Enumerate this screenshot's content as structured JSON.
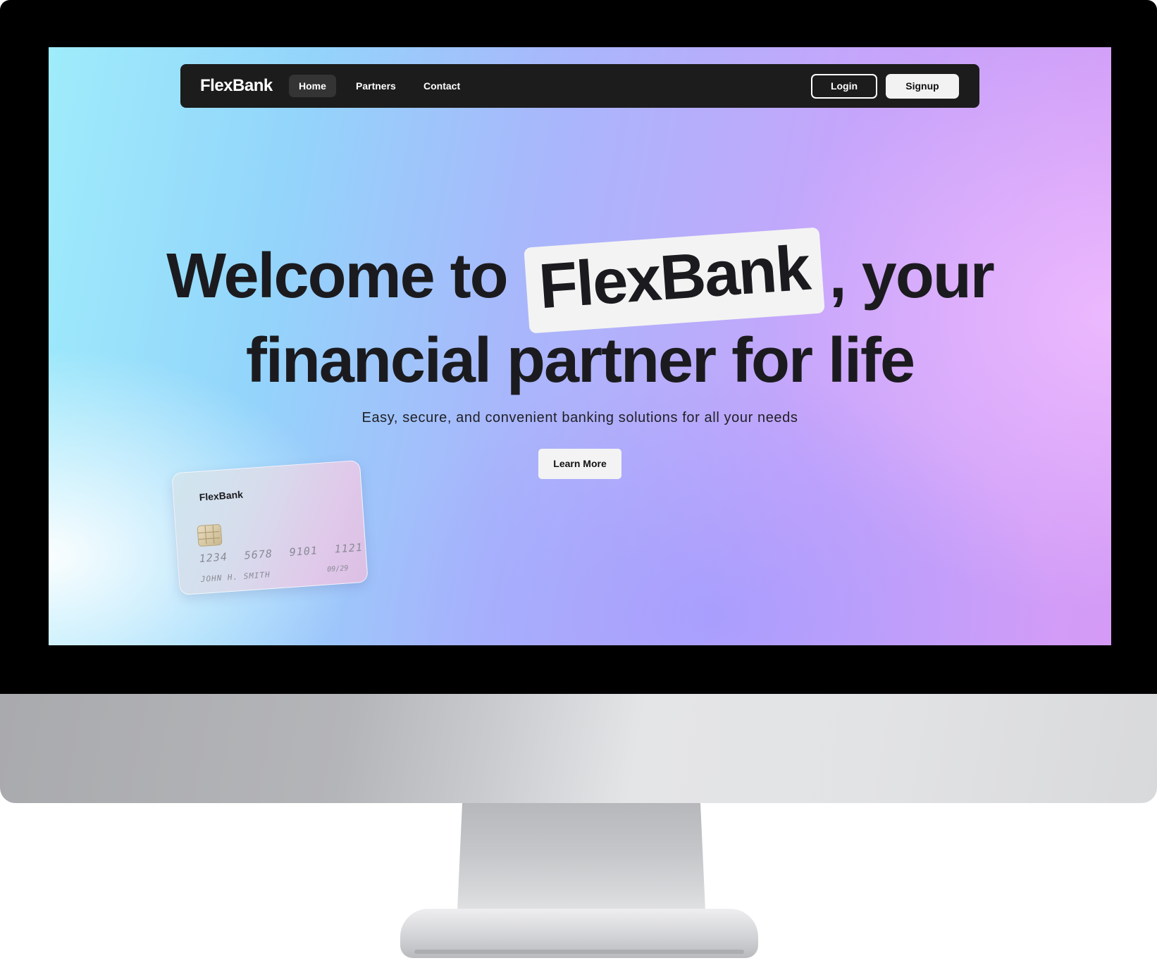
{
  "navbar": {
    "logo": "FlexBank",
    "links": [
      {
        "label": "Home",
        "active": true
      },
      {
        "label": "Partners",
        "active": false
      },
      {
        "label": "Contact",
        "active": false
      }
    ],
    "login_label": "Login",
    "signup_label": "Signup"
  },
  "hero": {
    "line1_before": "Welcome to",
    "highlight": "FlexBank",
    "line1_after": ", your",
    "line2": "financial partner for life",
    "subtitle": "Easy, secure, and convenient banking solutions for all your needs",
    "cta_label": "Learn More"
  },
  "card": {
    "brand": "FlexBank",
    "number": "1234 5678 9101 1121",
    "holder": "JOHN H. SMITH",
    "expiry": "09/29"
  },
  "colors": {
    "navbar_bg": "#1c1c1c",
    "text_dark": "#1b1b1f",
    "button_light": "#f3f3f3"
  }
}
